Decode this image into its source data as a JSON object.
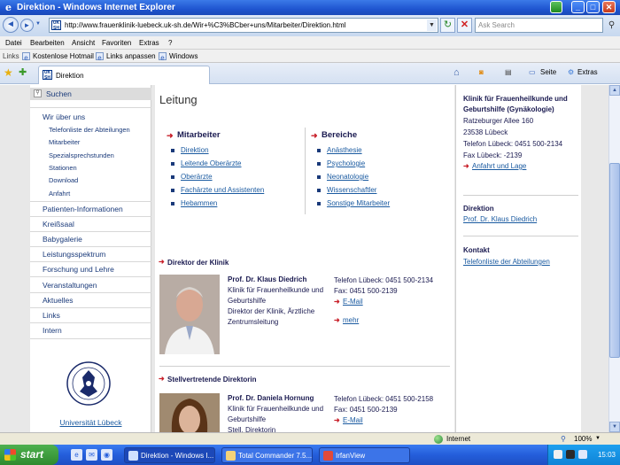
{
  "window": {
    "title": "Direktion - Windows Internet Explorer",
    "minimize_glyph": "_",
    "maximize_glyph": "□",
    "close_glyph": "✕"
  },
  "address": {
    "url": "http://www.frauenklinik-luebeck.uk-sh.de/Wir+%C3%BCber+uns/Mitarbeiter/Direktion.html",
    "favicon_text": "UK SH",
    "search_placeholder": "Ask Search",
    "back_glyph": "◄",
    "forward_glyph": "►",
    "dropdown_glyph": "▼",
    "reload_glyph": "↻",
    "stop_glyph": "✕",
    "search_glyph": "⚲"
  },
  "menu": [
    "Datei",
    "Bearbeiten",
    "Ansicht",
    "Favoriten",
    "Extras",
    "?"
  ],
  "links_bar": {
    "label": "Links",
    "items": [
      "Kostenlose Hotmail",
      "Links anpassen",
      "Windows"
    ]
  },
  "tabs": {
    "active": "Direktion",
    "favicon_text": "UK SH",
    "tools": {
      "page": "Seite",
      "extras": "Extras"
    }
  },
  "left_nav": {
    "search": "Suchen",
    "items": [
      {
        "label": "Wir über uns",
        "level": 1
      },
      {
        "label": "Telefonliste der Abteilungen",
        "level": 2
      },
      {
        "label": "Mitarbeiter",
        "level": 2
      },
      {
        "label": "Spezialsprechstunden",
        "level": 2
      },
      {
        "label": "Stationen",
        "level": 2
      },
      {
        "label": "Download",
        "level": 2
      },
      {
        "label": "Anfahrt",
        "level": 2
      },
      {
        "label": "Patienten-Informationen",
        "level": 1
      },
      {
        "label": "Kreißsaal",
        "level": 1
      },
      {
        "label": "Babygalerie",
        "level": 1
      },
      {
        "label": "Leistungsspektrum",
        "level": 1
      },
      {
        "label": "Forschung und Lehre",
        "level": 1
      },
      {
        "label": "Veranstaltungen",
        "level": 1
      },
      {
        "label": "Aktuelles",
        "level": 1
      },
      {
        "label": "Links",
        "level": 1
      },
      {
        "label": "Intern",
        "level": 1
      }
    ],
    "university": "Universität Lübeck"
  },
  "main": {
    "heading": "Leitung",
    "mitarbeiter": {
      "title": "Mitarbeiter",
      "links": [
        "Direktion",
        "Leitende Oberärzte",
        "Oberärzte",
        "Fachärzte und Assistenten",
        "Hebammen"
      ]
    },
    "bereiche": {
      "title": "Bereiche",
      "links": [
        "Anästhesie",
        "Psychologie",
        "Neonatologie",
        "Wissenschaftler",
        "Sonstige Mitarbeiter"
      ]
    },
    "director": {
      "section": "Direktor der Klinik",
      "name": "Prof. Dr. Klaus Diedrich",
      "lines": [
        "Klinik für Frauenheilkunde und",
        "Geburtshilfe",
        "Direktor der Klinik, Ärztliche",
        "Zentrumsleitung"
      ],
      "phone": "Telefon Lübeck: 0451 500-2134",
      "fax": "Fax: 0451 500-2139",
      "email": "E-Mail",
      "more": "mehr"
    },
    "deputy": {
      "section": "Stellvertretende Direktorin",
      "name": "Prof. Dr. Daniela Hornung",
      "lines": [
        "Klinik für Frauenheilkunde und",
        "Geburtshilfe",
        "Stell. Direktorin"
      ],
      "phone": "Telefon Lübeck: 0451 500-2158",
      "fax": "Fax: 0451 500-2139",
      "email": "E-Mail"
    }
  },
  "right_col": {
    "clinic_title_1": "Klinik für Frauenheilkunde und",
    "clinic_title_2": "Geburtshilfe (Gynäkologie)",
    "address_lines": [
      "Ratzeburger Allee 160",
      "23538 Lübeck",
      "Telefon Lübeck: 0451 500-2134",
      "Fax Lübeck: -2139"
    ],
    "directions": "Anfahrt und Lage",
    "direktion_title": "Direktion",
    "direktion_link": "Prof. Dr. Klaus Diedrich",
    "kontakt_title": "Kontakt",
    "kontakt_link": "Telefonliste der Abteilungen"
  },
  "status": {
    "zone": "Internet",
    "zoom": "100%"
  },
  "taskbar": {
    "start": "start",
    "tasks": [
      "Direktion - Windows I...",
      "Total Commander 7.5...",
      "IrfanView"
    ],
    "clock": "15:03"
  },
  "colors": {
    "accent_red": "#c8202a",
    "link_blue": "#1a5aa0",
    "nav_text": "#1a3a7a"
  }
}
